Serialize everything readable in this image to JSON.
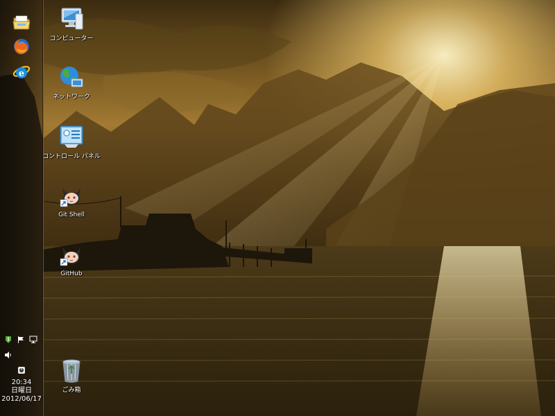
{
  "taskbar": {
    "pinned": [
      {
        "name": "explorer-taskbar-button",
        "icon": "folder-icon"
      },
      {
        "name": "firefox-taskbar-button",
        "icon": "firefox-icon"
      },
      {
        "name": "ie-taskbar-button",
        "icon": "internet-explorer-icon"
      }
    ],
    "tray_icons": [
      "action-center-icon",
      "flag-icon",
      "network-icon",
      "volume-icon",
      "power-icon"
    ],
    "clock": {
      "time": "20:34",
      "weekday": "日曜日",
      "date": "2012/06/17"
    }
  },
  "desktop": {
    "icons": [
      {
        "label": "コンピューター",
        "icon": "computer-icon"
      },
      {
        "label": "ネットワーク",
        "icon": "network-globe-icon"
      },
      {
        "label": "コントロール パネル",
        "icon": "control-panel-icon"
      },
      {
        "label": "Git Shell",
        "icon": "github-octocat-icon",
        "shortcut": true
      },
      {
        "label": "GitHub",
        "icon": "github-octocat-icon",
        "shortcut": true
      },
      {
        "label": "ごみ箱",
        "icon": "recycle-bin-icon"
      }
    ]
  },
  "colors": {
    "sun": "#fff1c2",
    "gold": "#b98a36",
    "silhouette": "#1d160b"
  }
}
